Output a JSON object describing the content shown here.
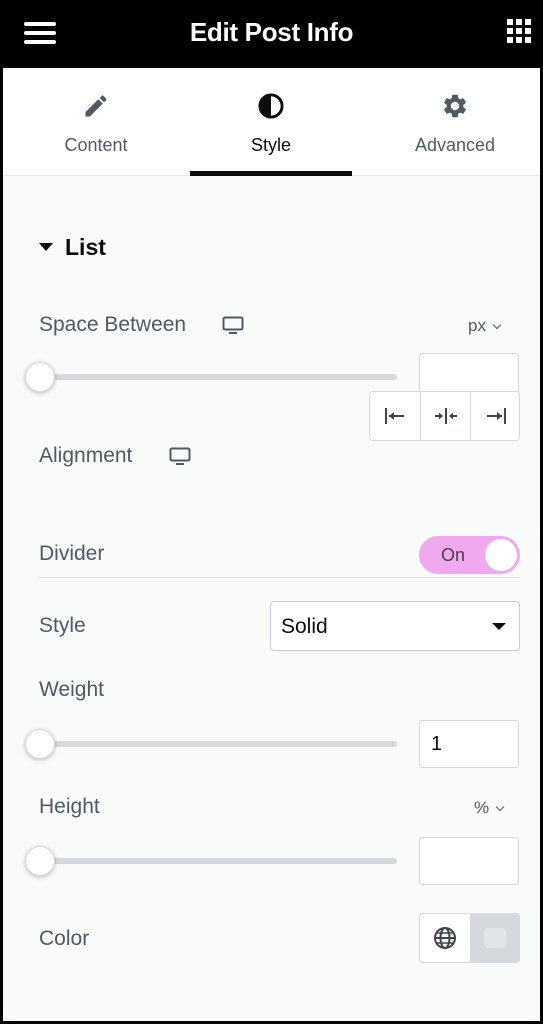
{
  "header": {
    "title": "Edit Post Info",
    "menu_icon": "hamburger-icon",
    "apps_icon": "grid-icon"
  },
  "tabs": [
    {
      "label": "Content",
      "icon": "pencil-icon",
      "active": false
    },
    {
      "label": "Style",
      "icon": "contrast-icon",
      "active": true
    },
    {
      "label": "Advanced",
      "icon": "gear-icon",
      "active": false
    }
  ],
  "section": {
    "title": "List"
  },
  "controls": {
    "space_between": {
      "label": "Space Between",
      "unit": "px",
      "value": "",
      "slider_level": 0
    },
    "alignment": {
      "label": "Alignment",
      "options": [
        "align-start-icon",
        "align-center-icon",
        "align-end-icon"
      ]
    },
    "divider": {
      "label": "Divider",
      "toggle_text": "On"
    },
    "style": {
      "label": "Style",
      "selected": "Solid"
    },
    "weight": {
      "label": "Weight",
      "value": "1",
      "slider_level": 0
    },
    "height": {
      "label": "Height",
      "unit": "%",
      "value": "",
      "slider_level": 0
    },
    "color": {
      "label": "Color",
      "global_icon": "globe-icon",
      "swatch": "#e2e4e7"
    }
  },
  "colors": {
    "header_bg": "#000000",
    "toggle_on": "#f0a8ef",
    "text": "#515962"
  }
}
